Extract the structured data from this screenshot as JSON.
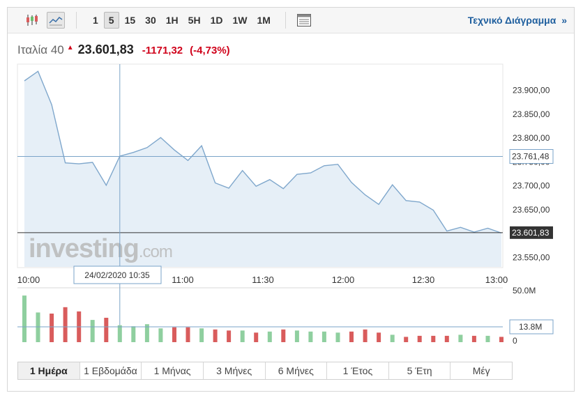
{
  "toolbar": {
    "intervals": [
      "1",
      "5",
      "15",
      "30",
      "1H",
      "5H",
      "1D",
      "1W",
      "1M"
    ],
    "active_interval": "5",
    "technical_chart_label": "Τεχνικό Διάγραμμα",
    "technical_chart_arrow": "»",
    "icons": [
      "candlestick-icon",
      "line-chart-icon",
      "table-icon"
    ]
  },
  "quote": {
    "name": "Ιταλία 40",
    "price": "23.601,83",
    "change": "-1171,32",
    "change_percent": "(-4,73%)",
    "direction_icon": "down-arrow-icon"
  },
  "colors": {
    "negative": "#d0021b",
    "line": "#7fa7cc",
    "area": "#e6eff7",
    "volume_up": "#8fcf9f",
    "volume_down": "#d95c5c",
    "link": "#1f5f9e"
  },
  "watermark": {
    "brand": "investing",
    "suffix": ".com"
  },
  "crosshair": {
    "time_label": "24/02/2020 10:35",
    "price_label": "23.761,48",
    "volume_label": "13.8M"
  },
  "last_price_label": "23.601,83",
  "chart_data": {
    "type": "area",
    "y_ticks": [
      "23.900,00",
      "23.850,00",
      "23.800,00",
      "23.750,00",
      "23.700,00",
      "23.650,00",
      "23.600,00",
      "23.550,00"
    ],
    "ylim": [
      23530,
      23955
    ],
    "x_ticks": [
      "10:00",
      "11:00",
      "11:30",
      "12:00",
      "12:30",
      "13:00"
    ],
    "series": [
      {
        "values": [
          23920,
          23940,
          23870,
          23748,
          23746,
          23749,
          23701,
          23762,
          23770,
          23780,
          23801,
          23775,
          23753,
          23784,
          23706,
          23695,
          23732,
          23699,
          23713,
          23694,
          23724,
          23727,
          23742,
          23745,
          23707,
          23681,
          23661,
          23702,
          23669,
          23666,
          23649,
          23605,
          23613,
          23603,
          23611,
          23601
        ]
      }
    ],
    "volume": {
      "axis_labels": [
        "50.0M",
        "0"
      ],
      "values": [
        44,
        28,
        27,
        33,
        29,
        21,
        23,
        16,
        15,
        17,
        13,
        14,
        14,
        13,
        12,
        11,
        11,
        9,
        10,
        12,
        11,
        10,
        10,
        9,
        10,
        12,
        9,
        7,
        5,
        6,
        6,
        6,
        7,
        6,
        6,
        5
      ],
      "direction": [
        "up",
        "up",
        "down",
        "down",
        "down",
        "up",
        "down",
        "up",
        "up",
        "up",
        "up",
        "down",
        "down",
        "up",
        "down",
        "down",
        "up",
        "down",
        "up",
        "down",
        "up",
        "up",
        "up",
        "up",
        "down",
        "down",
        "down",
        "up",
        "down",
        "down",
        "down",
        "down",
        "up",
        "down",
        "up",
        "down"
      ]
    }
  },
  "ranges": [
    "1 Ημέρα",
    "1 Εβδομάδα",
    "1 Μήνας",
    "3 Μήνες",
    "6 Μήνες",
    "1 Έτος",
    "5 Έτη",
    "Μέγ"
  ],
  "active_range": "1 Ημέρα"
}
